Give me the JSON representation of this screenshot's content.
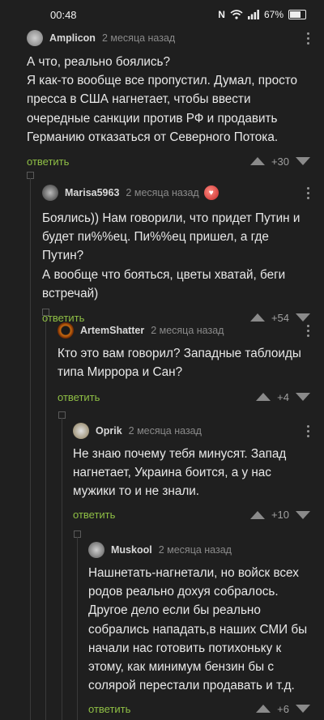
{
  "status_bar": {
    "time": "00:48",
    "battery": "67%",
    "nfc_label": "N"
  },
  "comments": [
    {
      "author": "Amplicon",
      "date": "2 месяца назад",
      "text_lines": [
        "А что, реально боялись?",
        "Я как-то вообще все пропустил. Думал, просто",
        "пресса в США нагнетает, чтобы ввести",
        "очередные санкции против РФ и продавить",
        "Германию отказаться от Северного Потока."
      ],
      "reply_label": "ответить",
      "score": "+30"
    },
    {
      "author": "Marisa5963",
      "date": "2 месяца назад",
      "text_lines": [
        "Боялись)) Нам говорили, что придет Путин и",
        "будет пи%%ец. Пи%%ец пришел, а где Путин?",
        "А вообще что бояться, цветы хватай, беги",
        "встречай)"
      ],
      "reply_label": "ответить",
      "score": "+54"
    },
    {
      "author": "ArtemShatter",
      "date": "2 месяца назад",
      "text_lines": [
        "Кто это вам говорил? Западные таблоиды",
        "типа Миррора и Сан?"
      ],
      "reply_label": "ответить",
      "score": "+4"
    },
    {
      "author": "Oprik",
      "date": "2 месяца назад",
      "text_lines": [
        "Не знаю почему тебя минусят. Запад",
        "нагнетает, Украина боится, а у нас",
        "мужики то и не знали."
      ],
      "reply_label": "ответить",
      "score": "+10"
    },
    {
      "author": "Muskool",
      "date": "2 месяца назад",
      "text_lines": [
        "Нашнетать-нагнетали, но войск всех",
        "родов  реально дохуя собралось.",
        "Другое дело если бы реально",
        "собрались нападать,в наших СМИ бы",
        "начали нас готовить потихоньку к",
        "этому, как минимум бензин бы с",
        "солярой перестали продавать и т.д."
      ],
      "reply_label": "ответить",
      "score": "+6"
    }
  ],
  "colors": {
    "background": "#1f1f1f",
    "reply": "#8fbf45",
    "muted": "#8a8a8a"
  }
}
